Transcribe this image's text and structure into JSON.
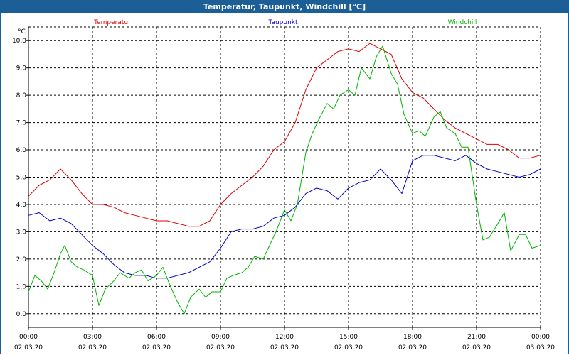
{
  "window": {
    "title": "Temperatur, Taupunkt, Windchill [°C]"
  },
  "colors": {
    "title_bar": "#1b5f96",
    "temperatur": "#e00000",
    "taupunkt": "#0000c8",
    "windchill": "#00b400",
    "grid": "#000000"
  },
  "chart_data": {
    "type": "line",
    "title": "Temperatur, Taupunkt, Windchill [°C]",
    "ylabel": "°C",
    "ylim": [
      -0.5,
      10.5
    ],
    "xlim": [
      0,
      24
    ],
    "grid": true,
    "legend_placement": "top",
    "y_ticks": [
      "0,0",
      "1,0",
      "2,0",
      "3,0",
      "4,0",
      "5,0",
      "6,0",
      "7,0",
      "8,0",
      "9,0",
      "10,0"
    ],
    "x_ticks": [
      {
        "time": "00:00",
        "date": "02.03.20"
      },
      {
        "time": "03:00",
        "date": "02.03.20"
      },
      {
        "time": "06:00",
        "date": "02.03.20"
      },
      {
        "time": "09:00",
        "date": "02.03.20"
      },
      {
        "time": "12:00",
        "date": "02.03.20"
      },
      {
        "time": "15:00",
        "date": "02.03.20"
      },
      {
        "time": "18:00",
        "date": "02.03.20"
      },
      {
        "time": "21:00",
        "date": "02.03.20"
      },
      {
        "time": "00:00",
        "date": "03.03.20"
      }
    ],
    "series": [
      {
        "name": "Temperatur",
        "color": "#e00000",
        "points": [
          [
            0,
            4.3
          ],
          [
            0.5,
            4.7
          ],
          [
            1,
            4.9
          ],
          [
            1.5,
            5.3
          ],
          [
            2,
            4.9
          ],
          [
            2.5,
            4.4
          ],
          [
            3,
            4.0
          ],
          [
            3.5,
            4.0
          ],
          [
            4,
            3.9
          ],
          [
            4.5,
            3.7
          ],
          [
            5,
            3.6
          ],
          [
            5.5,
            3.5
          ],
          [
            6,
            3.4
          ],
          [
            6.5,
            3.4
          ],
          [
            7,
            3.3
          ],
          [
            7.5,
            3.2
          ],
          [
            8,
            3.2
          ],
          [
            8.5,
            3.4
          ],
          [
            9,
            4.0
          ],
          [
            9.5,
            4.4
          ],
          [
            10,
            4.7
          ],
          [
            10.5,
            5.0
          ],
          [
            11,
            5.4
          ],
          [
            11.5,
            6.0
          ],
          [
            12,
            6.3
          ],
          [
            12.5,
            7.0
          ],
          [
            13,
            8.2
          ],
          [
            13.5,
            9.0
          ],
          [
            14,
            9.3
          ],
          [
            14.5,
            9.6
          ],
          [
            15,
            9.7
          ],
          [
            15.5,
            9.6
          ],
          [
            16,
            9.9
          ],
          [
            16.5,
            9.7
          ],
          [
            17,
            9.5
          ],
          [
            17.5,
            8.6
          ],
          [
            18,
            8.1
          ],
          [
            18.5,
            7.9
          ],
          [
            19,
            7.5
          ],
          [
            19.5,
            7.1
          ],
          [
            20,
            6.8
          ],
          [
            20.5,
            6.6
          ],
          [
            21,
            6.4
          ],
          [
            21.5,
            6.2
          ],
          [
            22,
            6.2
          ],
          [
            22.5,
            6.0
          ],
          [
            23,
            5.7
          ],
          [
            23.5,
            5.7
          ],
          [
            24,
            5.8
          ]
        ]
      },
      {
        "name": "Taupunkt",
        "color": "#0000c8",
        "points": [
          [
            0,
            3.6
          ],
          [
            0.5,
            3.7
          ],
          [
            1,
            3.4
          ],
          [
            1.5,
            3.5
          ],
          [
            2,
            3.3
          ],
          [
            2.5,
            2.9
          ],
          [
            3,
            2.5
          ],
          [
            3.5,
            2.2
          ],
          [
            4,
            1.8
          ],
          [
            4.5,
            1.5
          ],
          [
            5,
            1.4
          ],
          [
            5.5,
            1.4
          ],
          [
            6,
            1.3
          ],
          [
            6.5,
            1.3
          ],
          [
            7,
            1.4
          ],
          [
            7.5,
            1.5
          ],
          [
            8,
            1.7
          ],
          [
            8.5,
            1.9
          ],
          [
            9,
            2.4
          ],
          [
            9.5,
            3.0
          ],
          [
            10,
            3.1
          ],
          [
            10.5,
            3.1
          ],
          [
            11,
            3.2
          ],
          [
            11.5,
            3.5
          ],
          [
            12,
            3.6
          ],
          [
            12.5,
            3.9
          ],
          [
            13,
            4.4
          ],
          [
            13.5,
            4.6
          ],
          [
            14,
            4.5
          ],
          [
            14.5,
            4.2
          ],
          [
            15,
            4.6
          ],
          [
            15.5,
            4.8
          ],
          [
            16,
            4.9
          ],
          [
            16.5,
            5.3
          ],
          [
            17,
            4.9
          ],
          [
            17.5,
            4.4
          ],
          [
            18,
            5.6
          ],
          [
            18.5,
            5.8
          ],
          [
            19,
            5.8
          ],
          [
            19.5,
            5.7
          ],
          [
            20,
            5.6
          ],
          [
            20.5,
            5.8
          ],
          [
            21,
            5.5
          ],
          [
            21.5,
            5.3
          ],
          [
            22,
            5.2
          ],
          [
            22.5,
            5.1
          ],
          [
            23,
            5.0
          ],
          [
            23.5,
            5.1
          ],
          [
            24,
            5.3
          ]
        ]
      },
      {
        "name": "Windchill",
        "color": "#00b400",
        "points": [
          [
            0,
            0.8
          ],
          [
            0.3,
            1.4
          ],
          [
            0.6,
            1.2
          ],
          [
            0.9,
            0.9
          ],
          [
            1.2,
            1.5
          ],
          [
            1.5,
            2.2
          ],
          [
            1.7,
            2.5
          ],
          [
            2,
            1.9
          ],
          [
            2.3,
            1.7
          ],
          [
            2.6,
            1.6
          ],
          [
            3,
            1.4
          ],
          [
            3.3,
            0.3
          ],
          [
            3.6,
            0.9
          ],
          [
            4,
            1.2
          ],
          [
            4.3,
            1.5
          ],
          [
            4.7,
            1.3
          ],
          [
            5,
            1.5
          ],
          [
            5.3,
            1.6
          ],
          [
            5.6,
            1.2
          ],
          [
            6,
            1.4
          ],
          [
            6.3,
            1.7
          ],
          [
            6.6,
            1.1
          ],
          [
            7,
            0.4
          ],
          [
            7.3,
            0.0
          ],
          [
            7.6,
            0.6
          ],
          [
            8,
            0.9
          ],
          [
            8.3,
            0.6
          ],
          [
            8.6,
            0.8
          ],
          [
            9,
            0.8
          ],
          [
            9.3,
            1.3
          ],
          [
            9.6,
            1.4
          ],
          [
            10,
            1.5
          ],
          [
            10.3,
            1.7
          ],
          [
            10.6,
            2.1
          ],
          [
            11,
            2.0
          ],
          [
            11.3,
            2.5
          ],
          [
            11.6,
            3.0
          ],
          [
            12,
            3.8
          ],
          [
            12.3,
            3.4
          ],
          [
            12.6,
            4.0
          ],
          [
            13,
            5.9
          ],
          [
            13.3,
            6.6
          ],
          [
            13.6,
            7.1
          ],
          [
            14,
            7.7
          ],
          [
            14.3,
            7.5
          ],
          [
            14.6,
            8.0
          ],
          [
            15,
            8.2
          ],
          [
            15.3,
            8.0
          ],
          [
            15.6,
            9.0
          ],
          [
            16,
            8.6
          ],
          [
            16.3,
            9.4
          ],
          [
            16.6,
            9.8
          ],
          [
            17,
            8.8
          ],
          [
            17.3,
            8.4
          ],
          [
            17.6,
            7.3
          ],
          [
            18,
            6.6
          ],
          [
            18.3,
            6.7
          ],
          [
            18.6,
            6.5
          ],
          [
            19,
            7.2
          ],
          [
            19.3,
            7.4
          ],
          [
            19.6,
            6.8
          ],
          [
            20,
            6.6
          ],
          [
            20.3,
            6.1
          ],
          [
            20.6,
            6.1
          ],
          [
            21,
            4.0
          ],
          [
            21.3,
            2.7
          ],
          [
            21.6,
            2.8
          ],
          [
            22,
            3.3
          ],
          [
            22.3,
            3.7
          ],
          [
            22.6,
            2.3
          ],
          [
            23,
            2.9
          ],
          [
            23.3,
            2.9
          ],
          [
            23.6,
            2.4
          ],
          [
            24,
            2.5
          ]
        ]
      }
    ]
  }
}
